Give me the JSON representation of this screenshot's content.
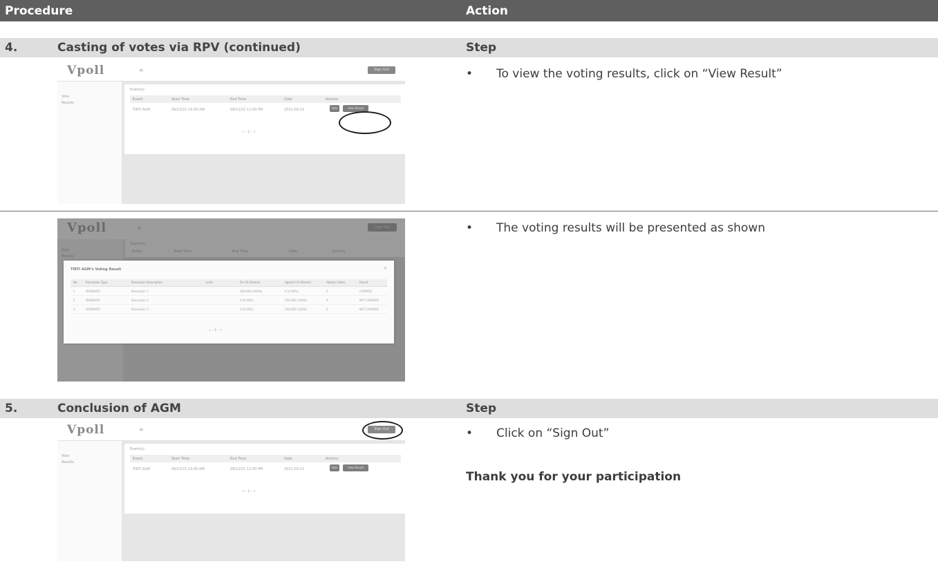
{
  "header": {
    "procedure": "Procedure",
    "action": "Action"
  },
  "section4": {
    "number": "4.",
    "title": "Casting of votes via RPV (continued)",
    "step": "Step"
  },
  "step4a": {
    "bullet": "•",
    "text": "To view the voting results, click on “View Result”"
  },
  "step4b": {
    "bullet": "•",
    "text": "The voting results will be presented as shown"
  },
  "section5": {
    "number": "5.",
    "title": "Conclusion of AGM",
    "step": "Step"
  },
  "step5": {
    "bullet": "•",
    "text": "Click on “Sign Out”",
    "thanks": "Thank you for your participation"
  },
  "app": {
    "logo": "Vpoll",
    "menu_glyph": "≡",
    "sign_out": "Sign Out",
    "sidebar": [
      "Vote",
      "Results"
    ],
    "panel_title": "Event(s)",
    "columns": [
      "Event",
      "Start Time",
      "End Time",
      "Date",
      "Actions"
    ],
    "event_row": {
      "event": "TIRTI AGM",
      "start": "09/12/21 10:00 AM",
      "end": "09/12/21 12:00 PM",
      "date": "2021-09-21",
      "vote_btn": "Vote",
      "result_btn": "View Result"
    },
    "pager": "«  ‹  1  ›  »"
  },
  "modal": {
    "title": "TIRTI AGM’s Voting Result",
    "close": "×",
    "columns": [
      "No",
      "Resolution Type",
      "Resolution Description",
      "Limit",
      "For (% Shares)",
      "Against (% Shares)",
      "Abstain Votes",
      "Result"
    ],
    "rows": [
      [
        "1",
        "ORDINARY",
        "Resolution 1",
        "",
        "500,000 (100%)",
        "0 (0.00%)",
        "0",
        "CARRIED"
      ],
      [
        "2",
        "ORDINARY",
        "Resolution 2",
        "",
        "0 (0.00%)",
        "500,000 (100%)",
        "0",
        "NOT CARRIED"
      ],
      [
        "3",
        "ORDINARY",
        "Resolution 3",
        "",
        "0 (0.00%)",
        "500,000 (100%)",
        "0",
        "NOT CARRIED"
      ]
    ],
    "pager": "«  ‹  1  ›  »"
  }
}
